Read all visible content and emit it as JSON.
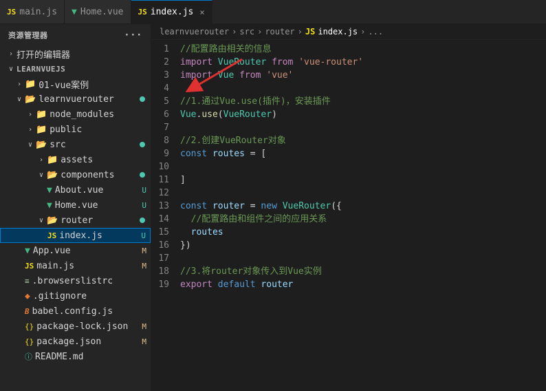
{
  "sidebar": {
    "title": "资源管理器",
    "dots": "···",
    "opened_section": "打开的编辑器",
    "learnvuejs": "LEARNVUEJS",
    "tree": [
      {
        "id": "learnvuejs-root",
        "label": "LEARNVUEJS",
        "type": "root",
        "indent": 0,
        "expanded": true,
        "icon": "folder"
      },
      {
        "id": "01-vue",
        "label": "01-vue案例",
        "type": "folder",
        "indent": 1,
        "expanded": false,
        "icon": "folder"
      },
      {
        "id": "learnvuerouter",
        "label": "learnvuerouter",
        "type": "folder",
        "indent": 1,
        "expanded": true,
        "icon": "folder",
        "dot": true
      },
      {
        "id": "node_modules",
        "label": "node_modules",
        "type": "folder",
        "indent": 2,
        "expanded": false,
        "icon": "folder"
      },
      {
        "id": "public",
        "label": "public",
        "type": "folder",
        "indent": 2,
        "expanded": false,
        "icon": "folder"
      },
      {
        "id": "src",
        "label": "src",
        "type": "folder",
        "indent": 2,
        "expanded": true,
        "icon": "folder",
        "dot": true
      },
      {
        "id": "assets",
        "label": "assets",
        "type": "folder",
        "indent": 3,
        "expanded": false,
        "icon": "folder"
      },
      {
        "id": "components",
        "label": "components",
        "type": "folder",
        "indent": 3,
        "expanded": true,
        "icon": "folder",
        "dot": true
      },
      {
        "id": "about-vue",
        "label": "About.vue",
        "type": "vue",
        "indent": 4,
        "badge": "U"
      },
      {
        "id": "home-vue",
        "label": "Home.vue",
        "type": "vue",
        "indent": 4,
        "badge": "U"
      },
      {
        "id": "router",
        "label": "router",
        "type": "folder",
        "indent": 3,
        "expanded": true,
        "icon": "folder",
        "dot": true
      },
      {
        "id": "index-js",
        "label": "index.js",
        "type": "js",
        "indent": 4,
        "badge": "U",
        "selected": true,
        "highlighted": true
      },
      {
        "id": "app-vue",
        "label": "App.vue",
        "type": "vue",
        "indent": 2,
        "badge": "M"
      },
      {
        "id": "main-js",
        "label": "main.js",
        "type": "js",
        "indent": 2,
        "badge": "M"
      },
      {
        "id": "browserslistrc",
        "label": ".browserslistrc",
        "type": "browsers",
        "indent": 2
      },
      {
        "id": "gitignore",
        "label": ".gitignore",
        "type": "git",
        "indent": 2
      },
      {
        "id": "babel-config",
        "label": "babel.config.js",
        "type": "babel",
        "indent": 2
      },
      {
        "id": "package-lock",
        "label": "package-lock.json",
        "type": "json",
        "indent": 2,
        "badge": "M"
      },
      {
        "id": "package-json",
        "label": "package.json",
        "type": "json",
        "indent": 2,
        "badge": "M"
      },
      {
        "id": "readme",
        "label": "README.md",
        "type": "readme",
        "indent": 2
      }
    ]
  },
  "tabs": [
    {
      "id": "main-js-tab",
      "label": "main.js",
      "type": "js",
      "active": false
    },
    {
      "id": "home-vue-tab",
      "label": "Home.vue",
      "type": "vue",
      "active": false
    },
    {
      "id": "index-js-tab",
      "label": "index.js",
      "type": "js",
      "active": true,
      "closable": true
    }
  ],
  "breadcrumb": {
    "parts": [
      "learnvuerouter",
      ">",
      "src",
      ">",
      "router",
      ">",
      "JS index.js",
      ">",
      "..."
    ]
  },
  "code": {
    "lines": [
      {
        "num": 1,
        "tokens": [
          {
            "type": "comment",
            "text": "//配置路由相关的信息"
          }
        ]
      },
      {
        "num": 2,
        "tokens": [
          {
            "type": "import-kw",
            "text": "import"
          },
          {
            "type": "text",
            "text": " "
          },
          {
            "type": "class",
            "text": "VueRouter"
          },
          {
            "type": "text",
            "text": " "
          },
          {
            "type": "import-kw",
            "text": "from"
          },
          {
            "type": "text",
            "text": " "
          },
          {
            "type": "string",
            "text": "'vue-router'"
          }
        ]
      },
      {
        "num": 3,
        "tokens": [
          {
            "type": "import-kw",
            "text": "import"
          },
          {
            "type": "text",
            "text": " "
          },
          {
            "type": "class",
            "text": "Vue"
          },
          {
            "type": "text",
            "text": " "
          },
          {
            "type": "import-kw",
            "text": "from"
          },
          {
            "type": "text",
            "text": " "
          },
          {
            "type": "string",
            "text": "'vue'"
          }
        ]
      },
      {
        "num": 4,
        "tokens": []
      },
      {
        "num": 5,
        "tokens": [
          {
            "type": "comment",
            "text": "//1.通过Vue.use(插件)，安装插件"
          }
        ]
      },
      {
        "num": 6,
        "tokens": [
          {
            "type": "class",
            "text": "Vue"
          },
          {
            "type": "text",
            "text": "."
          },
          {
            "type": "function",
            "text": "use"
          },
          {
            "type": "text",
            "text": "("
          },
          {
            "type": "class",
            "text": "VueRouter"
          },
          {
            "type": "text",
            "text": ")"
          }
        ]
      },
      {
        "num": 7,
        "tokens": []
      },
      {
        "num": 8,
        "tokens": [
          {
            "type": "comment",
            "text": "//2.创建VueRouter对象"
          }
        ]
      },
      {
        "num": 9,
        "tokens": [
          {
            "type": "keyword",
            "text": "const"
          },
          {
            "type": "text",
            "text": " "
          },
          {
            "type": "variable",
            "text": "routes"
          },
          {
            "type": "text",
            "text": " = ["
          }
        ]
      },
      {
        "num": 10,
        "tokens": []
      },
      {
        "num": 11,
        "tokens": [
          {
            "type": "text",
            "text": "]"
          }
        ]
      },
      {
        "num": 12,
        "tokens": []
      },
      {
        "num": 13,
        "tokens": [
          {
            "type": "keyword",
            "text": "const"
          },
          {
            "type": "text",
            "text": " "
          },
          {
            "type": "variable",
            "text": "router"
          },
          {
            "type": "text",
            "text": " = "
          },
          {
            "type": "keyword",
            "text": "new"
          },
          {
            "type": "text",
            "text": " "
          },
          {
            "type": "class",
            "text": "VueRouter"
          },
          {
            "type": "text",
            "text": "({"
          }
        ]
      },
      {
        "num": 14,
        "tokens": [
          {
            "type": "comment",
            "text": "  //配置路由和组件之间的应用关系"
          }
        ]
      },
      {
        "num": 15,
        "tokens": [
          {
            "type": "text",
            "text": "  "
          },
          {
            "type": "variable",
            "text": "routes"
          }
        ]
      },
      {
        "num": 16,
        "tokens": [
          {
            "type": "text",
            "text": "})"
          }
        ]
      },
      {
        "num": 17,
        "tokens": []
      },
      {
        "num": 18,
        "tokens": [
          {
            "type": "comment",
            "text": "//3.将router对象传入到Vue实例"
          }
        ]
      },
      {
        "num": 19,
        "tokens": [
          {
            "type": "import-kw",
            "text": "export"
          },
          {
            "type": "text",
            "text": " "
          },
          {
            "type": "keyword",
            "text": "default"
          },
          {
            "type": "text",
            "text": " "
          },
          {
            "type": "variable",
            "text": "router"
          }
        ]
      }
    ]
  }
}
